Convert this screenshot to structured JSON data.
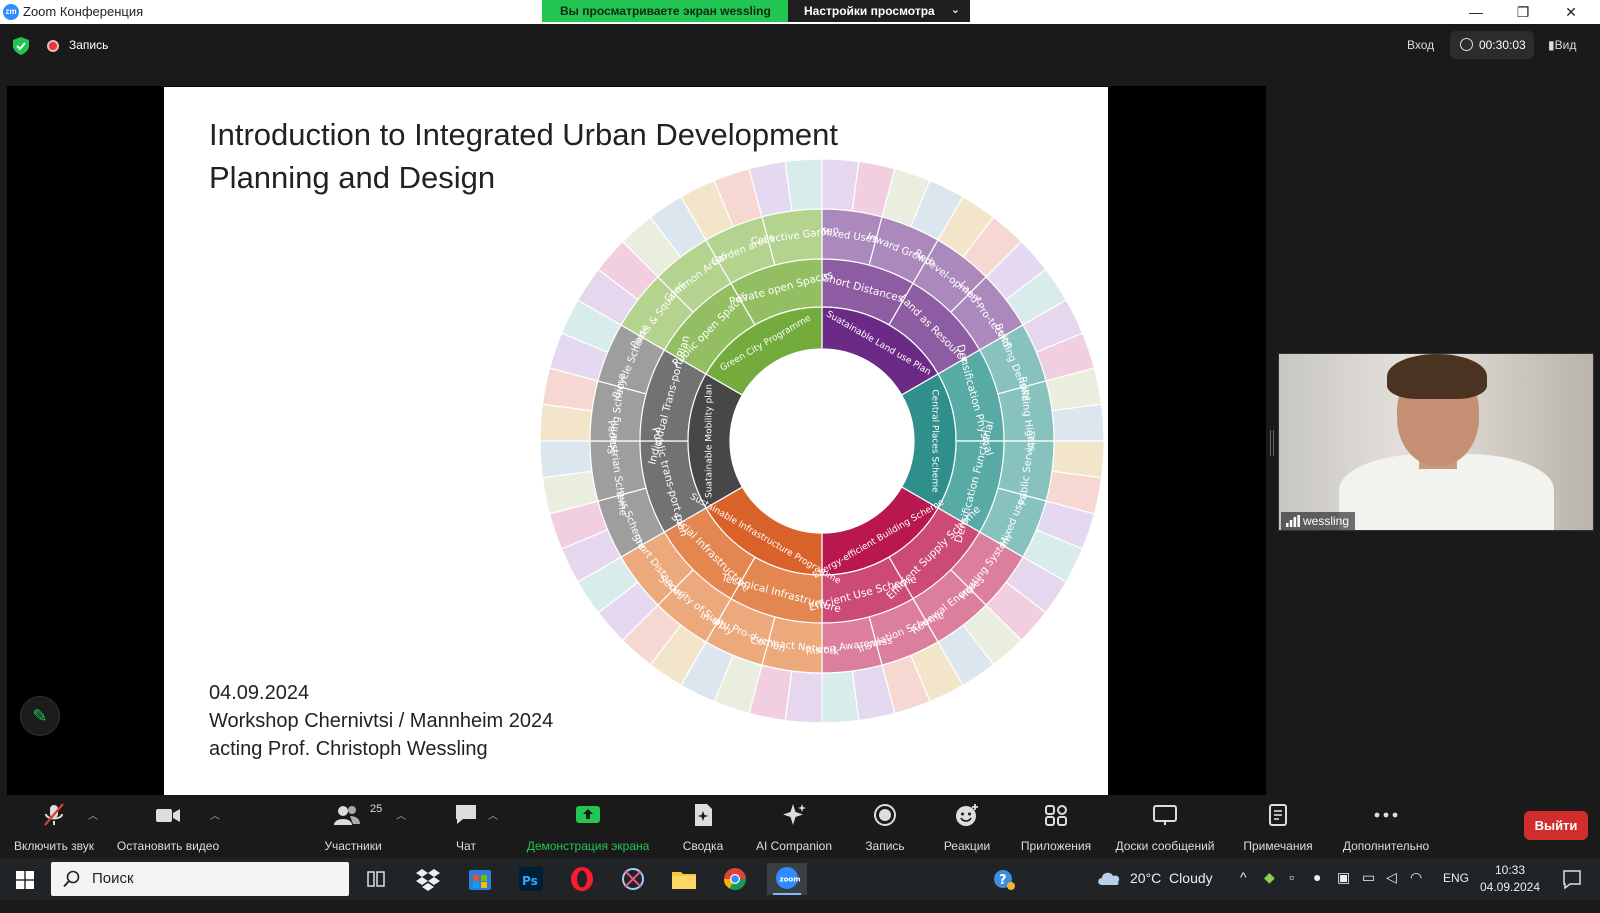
{
  "window": {
    "title": "Zoom Конференция",
    "app_icon_text": "zm",
    "share_banner_text": "Вы просматриваете экран wessling",
    "view_settings_label": "Настройки просмотра",
    "minimize_glyph": "—",
    "maximize_glyph": "❐",
    "close_glyph": "✕"
  },
  "topbar": {
    "record_label": "Запись",
    "login_label": "Вход",
    "timer": "00:30:03",
    "view_label": "Вид"
  },
  "slide": {
    "title_line1": "Introduction to Integrated Urban Development",
    "title_line2": "Planning and Design",
    "date": "04.09.2024",
    "workshop": "Workshop Chernivtsi / Mannheim 2024",
    "presenter": "acting Prof. Christoph Wessling",
    "wheel_inner": [
      {
        "label": "Suatainable Land use Plan",
        "color": "#6a2a86"
      },
      {
        "label": "Central Places Scheme",
        "color": "#2f8f8a"
      },
      {
        "label": "Energy-efficient Building Scheme",
        "color": "#b8174f"
      },
      {
        "label": "Sustainable Infrastructure Programme",
        "color": "#d9622a"
      },
      {
        "label": "Suatainable Mobility plan",
        "color": "#474747"
      },
      {
        "label": "Green City Programme",
        "color": "#73ab3c"
      }
    ],
    "wheel_middle": [
      {
        "label": "Short Distances",
        "color": "#8d5ca3"
      },
      {
        "label": "Land as Resource",
        "color": "#8d5ca3"
      },
      {
        "label": "Densification Physical",
        "color": "#58aaa5"
      },
      {
        "label": "Densification Functional",
        "color": "#58aaa5"
      },
      {
        "label": "Efficient Supply Scheme",
        "color": "#cb4b74"
      },
      {
        "label": "Efficient Use Scheme",
        "color": "#cb4b74"
      },
      {
        "label": "Technical Infrastructure",
        "color": "#e38650"
      },
      {
        "label": "Social Infrastructure",
        "color": "#e38650"
      },
      {
        "label": "Public trans-port plan",
        "color": "#727272"
      },
      {
        "label": "Individual Trans-port Plan",
        "color": "#727272"
      },
      {
        "label": "Public open Spaces",
        "color": "#93bf62"
      },
      {
        "label": "Private open Spaces",
        "color": "#93bf62"
      }
    ],
    "wheel_outer": [
      {
        "label": "Mixed Uses",
        "color": "#ab89bd"
      },
      {
        "label": "Inward Growth",
        "color": "#ab89bd"
      },
      {
        "label": "Redevel-opment",
        "color": "#ab89bd"
      },
      {
        "label": "Land Pro-tection",
        "color": "#ab89bd"
      },
      {
        "label": "Building Density",
        "color": "#87c2be"
      },
      {
        "label": "Building Hights",
        "color": "#87c2be"
      },
      {
        "label": "Public Services",
        "color": "#87c2be"
      },
      {
        "label": "Mixed uses",
        "color": "#87c2be"
      },
      {
        "label": "Heating System",
        "color": "#dc7f9d"
      },
      {
        "label": "Renewal Energies",
        "color": "#dc7f9d"
      },
      {
        "label": "Insulation Scheme",
        "color": "#dc7f9d"
      },
      {
        "label": "Rising Awareness",
        "color": "#dc7f9d"
      },
      {
        "label": "Compact Network",
        "color": "#eba97c"
      },
      {
        "label": "In-situ Pro-duction",
        "color": "#eba97c"
      },
      {
        "label": "Security of Supply",
        "color": "#eba97c"
      },
      {
        "label": "Short Distances",
        "color": "#eba97c"
      },
      {
        "label": "Bus Scheme",
        "color": "#9e9e9e"
      },
      {
        "label": "Pedestrian Scheme",
        "color": "#9e9e9e"
      },
      {
        "label": "Sharing Scheme",
        "color": "#9e9e9e"
      },
      {
        "label": "Bicycle Scheme",
        "color": "#9e9e9e"
      },
      {
        "label": "Parks & Squares",
        "color": "#b3d38e"
      },
      {
        "label": "Common Areas",
        "color": "#b3d38e"
      },
      {
        "label": "Garden areas",
        "color": "#b3d38e"
      },
      {
        "label": "Collective Garden",
        "color": "#b3d38e"
      }
    ],
    "wheel_rim_colors": [
      "#e6d7ee",
      "#f2cfe0",
      "#e9eedf",
      "#dbe6ef",
      "#f3e5c9",
      "#f6d7d2",
      "#e4d9f0",
      "#d9ecec"
    ]
  },
  "participant_video": {
    "name": "wessling"
  },
  "toolbar": {
    "items": [
      {
        "label": "Включить звук",
        "icon": "microphone-muted-icon"
      },
      {
        "label": "Остановить видео",
        "icon": "video-camera-icon"
      },
      {
        "label": "Участники",
        "icon": "participants-icon",
        "count": "25"
      },
      {
        "label": "Чат",
        "icon": "chat-icon"
      },
      {
        "label": "Демонстрация экрана",
        "icon": "share-screen-icon"
      },
      {
        "label": "Сводка",
        "icon": "summary-icon"
      },
      {
        "label": "AI Companion",
        "icon": "ai-companion-icon"
      },
      {
        "label": "Запись",
        "icon": "record-icon"
      },
      {
        "label": "Реакции",
        "icon": "reactions-icon"
      },
      {
        "label": "Приложения",
        "icon": "apps-icon"
      },
      {
        "label": "Доски сообщений",
        "icon": "whiteboards-icon"
      },
      {
        "label": "Примечания",
        "icon": "notes-icon"
      },
      {
        "label": "Дополнительно",
        "icon": "more-icon"
      }
    ],
    "leave_label": "Выйти"
  },
  "taskbar": {
    "search_placeholder": "Поиск",
    "weather": "20°C  Cloudy",
    "language": "ENG",
    "time": "10:33",
    "date": "04.09.2024"
  },
  "colors": {
    "zoom_green": "#23c552",
    "leave_red": "#d22d2d",
    "zoom_blue": "#2d8cff"
  }
}
